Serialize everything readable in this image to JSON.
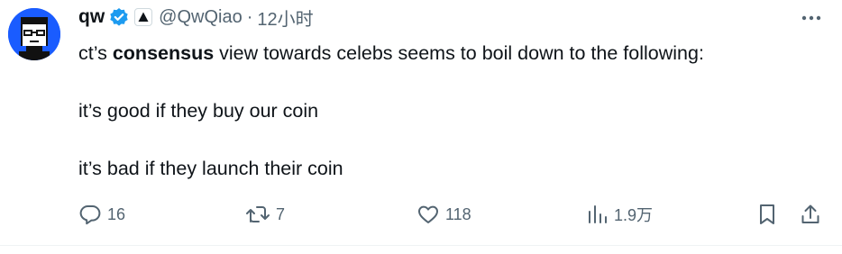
{
  "user": {
    "name": "qw",
    "handle": "@QwQiao",
    "separator": "·",
    "time": "12小时"
  },
  "tweet": {
    "line1": {
      "pre": "ct’s ",
      "bold": "consensus",
      "post": " view towards celebs seems to boil down to the following:"
    },
    "line2": "it’s good if they buy our coin",
    "line3": "it’s bad if they launch their coin"
  },
  "actions": {
    "replies": "16",
    "retweets": "7",
    "likes": "118",
    "views": "1.9万"
  },
  "colors": {
    "text": "#0f1419",
    "secondary": "#536471",
    "verified": "#1d9bf0",
    "avatar_bg": "#1a5cff"
  },
  "icons": {
    "verified": "verified-badge-icon",
    "affiliate": "affiliate-badge-icon",
    "more": "more-dots-icon",
    "reply": "reply-icon",
    "retweet": "retweet-icon",
    "like": "heart-icon",
    "views": "views-bar-chart-icon",
    "bookmark": "bookmark-icon",
    "share": "share-icon"
  }
}
